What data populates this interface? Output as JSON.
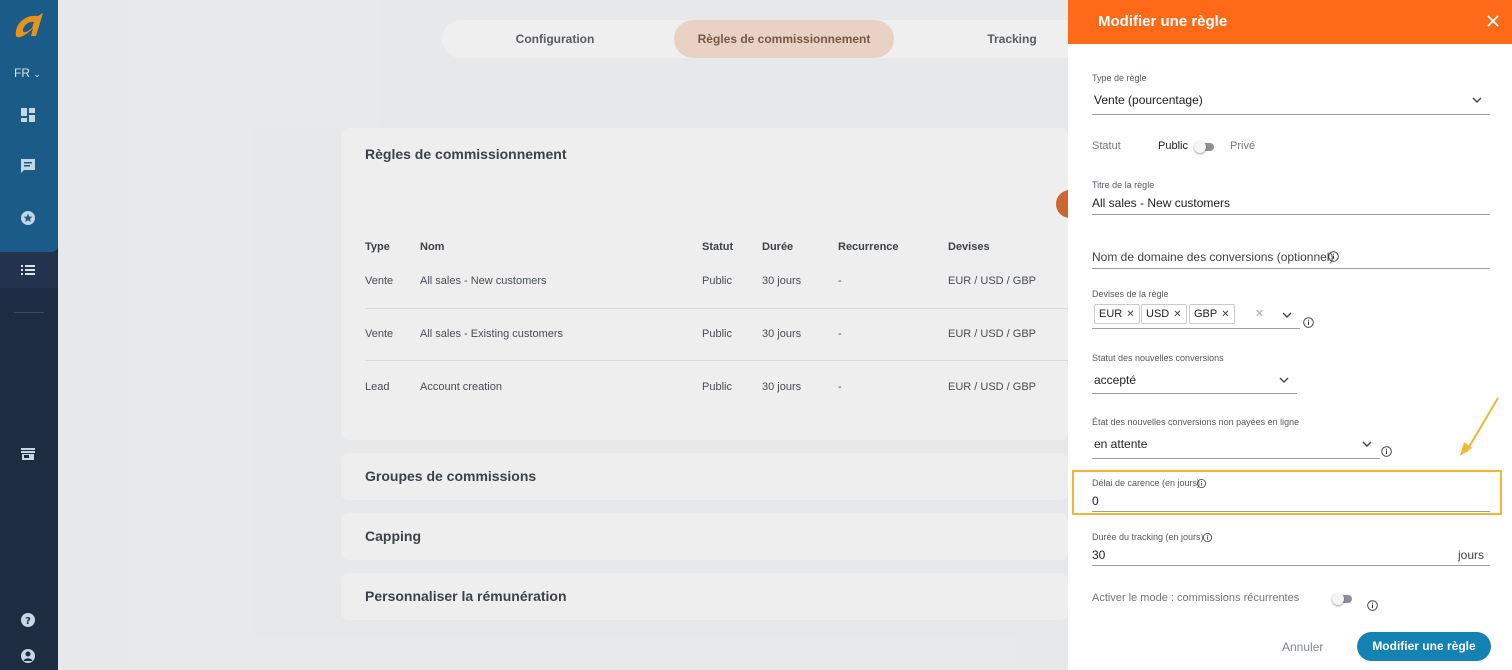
{
  "sidebar": {
    "language": "FR",
    "icons": [
      "dashboard-icon",
      "chat-icon",
      "star-badge-icon",
      "list-icon",
      "store-icon",
      "help-icon",
      "user-icon"
    ],
    "accent_color": "#1b5e8d"
  },
  "tabs": [
    {
      "label": "Configuration",
      "active": false
    },
    {
      "label": "Règles de commissionnement",
      "active": true
    },
    {
      "label": "Tracking",
      "active": false
    }
  ],
  "rules_card": {
    "title": "Règles de commissionnement",
    "columns": [
      "Type",
      "Nom",
      "Statut",
      "Durée",
      "Recurrence",
      "Devises"
    ],
    "rows": [
      {
        "type": "Vente",
        "name": "All sales - New customers",
        "status": "Public",
        "duration": "30 jours",
        "recurrence": "-",
        "currencies": "EUR / USD / GBP"
      },
      {
        "type": "Vente",
        "name": "All sales - Existing customers",
        "status": "Public",
        "duration": "30 jours",
        "recurrence": "-",
        "currencies": "EUR / USD / GBP"
      },
      {
        "type": "Lead",
        "name": "Account creation",
        "status": "Public",
        "duration": "30 jours",
        "recurrence": "-",
        "currencies": "EUR / USD / GBP"
      }
    ]
  },
  "sections": [
    "Groupes de commissions",
    "Capping",
    "Personnaliser la rémunération"
  ],
  "drawer": {
    "title": "Modifier une règle",
    "header_color": "#fe6a17",
    "rule_type": {
      "label": "Type de règle",
      "value": "Vente (pourcentage)"
    },
    "status": {
      "label": "Statut",
      "on_label": "Public",
      "off_label": "Privé"
    },
    "rule_title": {
      "label": "Titre de la règle",
      "value": "All sales - New customers"
    },
    "domain": {
      "placeholder": "Nom de domaine des conversions (optionnel)"
    },
    "currencies": {
      "label": "Devises de la règle",
      "chips": [
        "EUR",
        "USD",
        "GBP"
      ]
    },
    "new_conv_status": {
      "label": "Statut des nouvelles conversions",
      "value": "accepté"
    },
    "unpaid_state": {
      "label": "État des nouvelles conversions non payées en ligne",
      "value": "en attente"
    },
    "grace_period": {
      "label": "Délai de carence (en jours)",
      "value": "0"
    },
    "tracking_duration": {
      "label": "Durée du tracking (en jours)",
      "value": "30",
      "unit": "jours"
    },
    "recurring": {
      "label": "Activer le mode : commissions récurrentes"
    },
    "cancel_label": "Annuler",
    "submit_label": "Modifier une règle",
    "submit_color": "#1582b4"
  }
}
